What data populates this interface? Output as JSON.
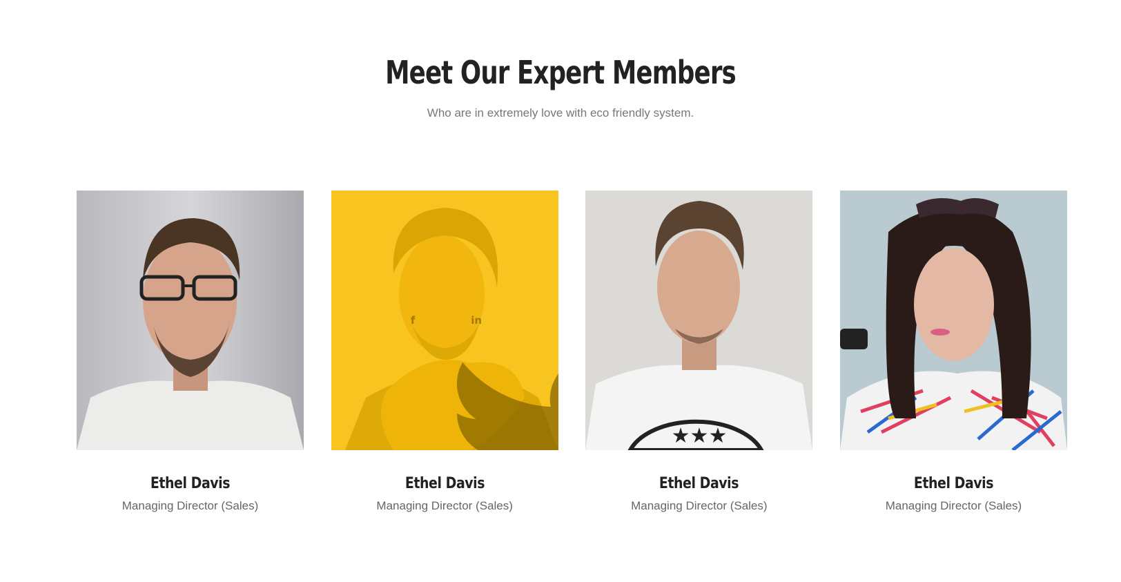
{
  "section": {
    "title": "Meet Our Expert Members",
    "subtitle": "Who are in extremely love with eco friendly system."
  },
  "members": [
    {
      "name": "Ethel Davis",
      "role": "Managing Director (Sales)",
      "photo": "man-with-glasses-portrait"
    },
    {
      "name": "Ethel Davis",
      "role": "Managing Director (Sales)",
      "photo": "man-with-scarf-portrait",
      "hovered": true
    },
    {
      "name": "Ethel Davis",
      "role": "Managing Director (Sales)",
      "photo": "man-in-white-tshirt-portrait"
    },
    {
      "name": "Ethel Davis",
      "role": "Managing Director (Sales)",
      "photo": "woman-with-sunglasses-portrait"
    }
  ],
  "social_icons": [
    "facebook-icon",
    "twitter-icon",
    "linkedin-icon"
  ],
  "colors": {
    "accent": "#fabe00",
    "heading": "#222222",
    "muted": "#777777"
  }
}
